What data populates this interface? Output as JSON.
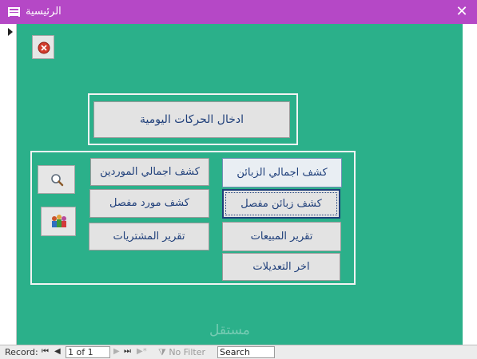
{
  "window": {
    "title": "الرئيسية"
  },
  "buttons": {
    "daily_transactions": "ادخال الحركات اليومية",
    "customers_total": "كشف اجمالي الزبائن",
    "suppliers_total": "كشف اجمالي الموردين",
    "customers_detailed": "كشف زبائن مفصل",
    "supplier_detailed": "كشف مورد مفصل",
    "sales_report": "تقرير المبيعات",
    "purchases_report": "تقرير المشتريات",
    "last_edits": "اخر التعديلات"
  },
  "status_bar": {
    "record_label": "Record:",
    "record_value": "1 of 1",
    "filter_label": "No Filter",
    "search_placeholder": "Search"
  },
  "watermark": "مستقل",
  "colors": {
    "title_bar": "#b548c6",
    "canvas": "#2bb08a",
    "button_text": "#1f3f7a"
  }
}
